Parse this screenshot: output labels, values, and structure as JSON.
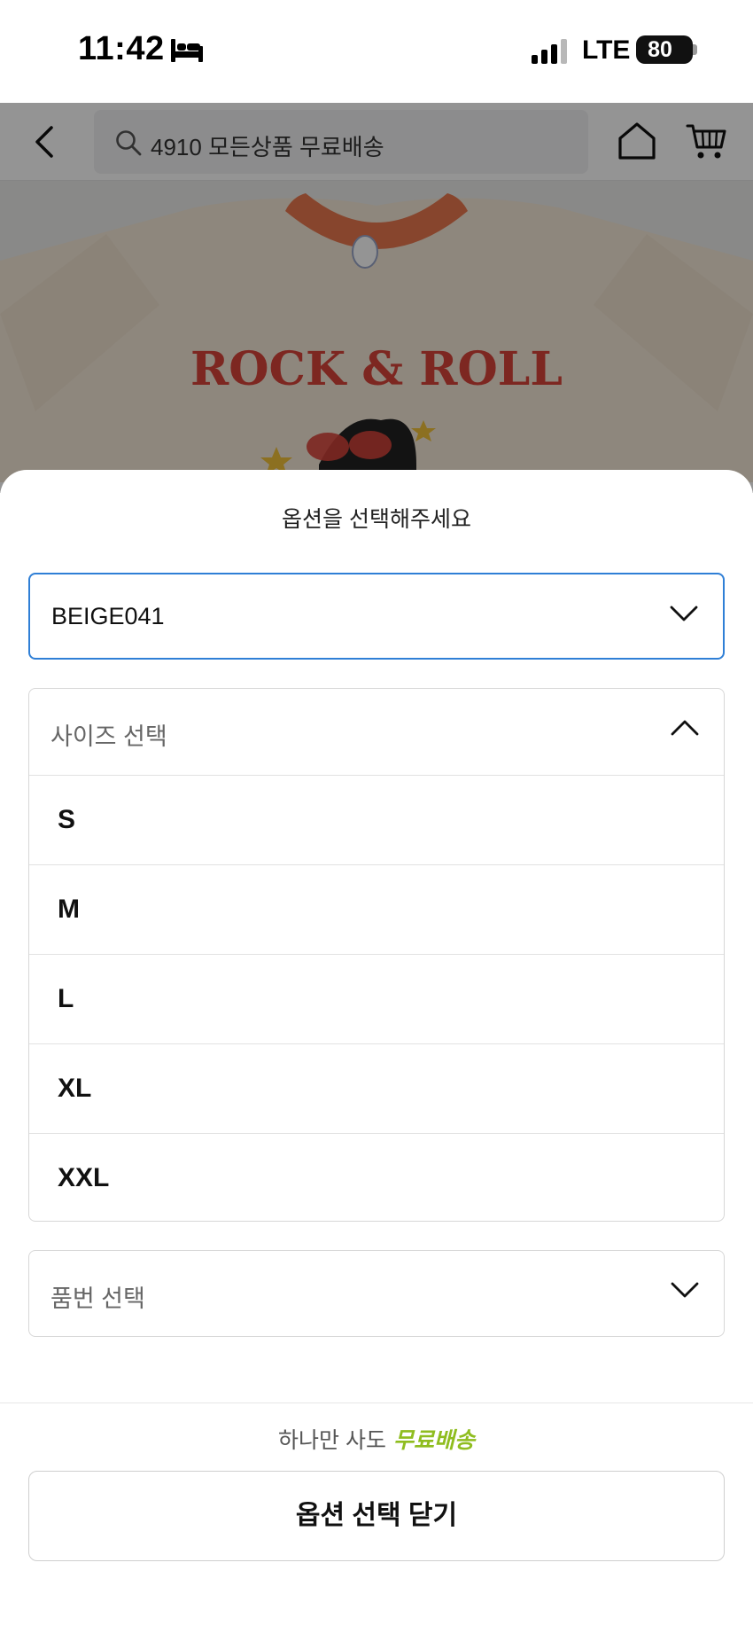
{
  "status_bar": {
    "time": "11:42",
    "network": "LTE",
    "battery": "80",
    "icons": [
      "bed-icon",
      "signal-icon",
      "battery-icon"
    ]
  },
  "header": {
    "search_text": "4910 모든상품 무료배송",
    "icons": [
      "back-arrow-icon",
      "search-icon",
      "home-icon",
      "cart-icon"
    ]
  },
  "product": {
    "print_text": "ROCK & ROLL"
  },
  "sheet": {
    "title": "옵션을 선택해주세요",
    "color_select": {
      "value": "BEIGE041"
    },
    "size_select": {
      "placeholder": "사이즈 선택",
      "expanded": true,
      "options": [
        "S",
        "M",
        "L",
        "XL",
        "XXL"
      ]
    },
    "item_select": {
      "placeholder": "품번 선택"
    },
    "promo": {
      "prefix": "하나만 사도",
      "highlight": "무료배송"
    },
    "close_button": "옵션 선택 닫기"
  },
  "colors": {
    "focus_border": "#2f7fd6",
    "promo_green": "#8fbd1f",
    "overlay": "rgba(0,0,0,0.42)"
  }
}
